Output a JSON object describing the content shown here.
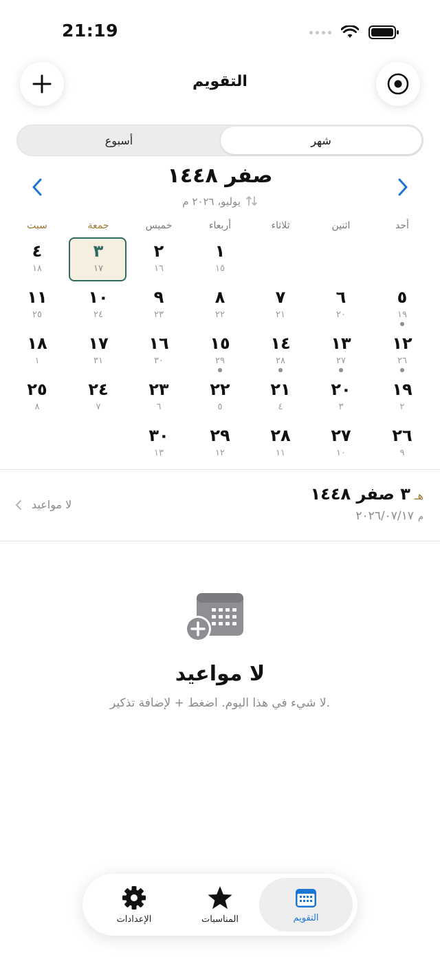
{
  "status_bar": {
    "time": "21:19"
  },
  "header": {
    "title": "التقويم",
    "add_icon": "plus-icon",
    "locate_icon": "target-icon"
  },
  "view_toggle": {
    "month_label": "شهر",
    "week_label": "أسبوع",
    "selected": "شهر"
  },
  "month": {
    "hijri_title": "صفر ١٤٤٨",
    "gregorian_sub": "يوليو، ٢٠٢٦ م",
    "swap_icon": "swap-arrows-icon"
  },
  "weekdays": [
    "أحد",
    "اثنين",
    "ثلاثاء",
    "أربعاء",
    "خميس",
    "جمعة",
    "سبت"
  ],
  "weekend_color": "#9b7a33",
  "accent_color": "#2f6b5e",
  "weeks": [
    [
      null,
      null,
      null,
      {
        "h": "١",
        "g": "١٥"
      },
      {
        "h": "٢",
        "g": "١٦"
      },
      {
        "h": "٣",
        "g": "١٧",
        "today": true
      },
      {
        "h": "٤",
        "g": "١٨"
      }
    ],
    [
      {
        "h": "٥",
        "g": "١٩",
        "dot": true
      },
      {
        "h": "٦",
        "g": "٢٠"
      },
      {
        "h": "٧",
        "g": "٢١"
      },
      {
        "h": "٨",
        "g": "٢٢"
      },
      {
        "h": "٩",
        "g": "٢٣"
      },
      {
        "h": "١٠",
        "g": "٢٤"
      },
      {
        "h": "١١",
        "g": "٢٥"
      }
    ],
    [
      {
        "h": "١٢",
        "g": "٢٦",
        "dot": true
      },
      {
        "h": "١٣",
        "g": "٢٧",
        "dot": true
      },
      {
        "h": "١٤",
        "g": "٢٨",
        "dot": true
      },
      {
        "h": "١٥",
        "g": "٢٩",
        "dot": true
      },
      {
        "h": "١٦",
        "g": "٣٠"
      },
      {
        "h": "١٧",
        "g": "٣١"
      },
      {
        "h": "١٨",
        "g": "١"
      }
    ],
    [
      {
        "h": "١٩",
        "g": "٢"
      },
      {
        "h": "٢٠",
        "g": "٣"
      },
      {
        "h": "٢١",
        "g": "٤"
      },
      {
        "h": "٢٢",
        "g": "٥"
      },
      {
        "h": "٢٣",
        "g": "٦"
      },
      {
        "h": "٢٤",
        "g": "٧"
      },
      {
        "h": "٢٥",
        "g": "٨"
      }
    ],
    [
      {
        "h": "٢٦",
        "g": "٩"
      },
      {
        "h": "٢٧",
        "g": "١٠"
      },
      {
        "h": "٢٨",
        "g": "١١"
      },
      {
        "h": "٢٩",
        "g": "١٢"
      },
      {
        "h": "٣٠",
        "g": "١٣"
      },
      null,
      null
    ]
  ],
  "selected_day": {
    "era_hijri": "هـ",
    "hijri": "٣ صفر ١٤٤٨",
    "era_gregorian": "م",
    "gregorian": "٢٠٢٦/٠٧/١٧",
    "appointments_link": "لا مواعيد"
  },
  "empty_state": {
    "icon": "calendar-add-icon",
    "title": "لا مواعيد",
    "subtitle": "لا شيء في هذا اليوم. اضغط + لإضافة تذكير."
  },
  "tabbar": {
    "calendar": "التقويم",
    "occasions": "المناسبات",
    "settings": "الإعدادات",
    "active_color": "#1976d2"
  }
}
